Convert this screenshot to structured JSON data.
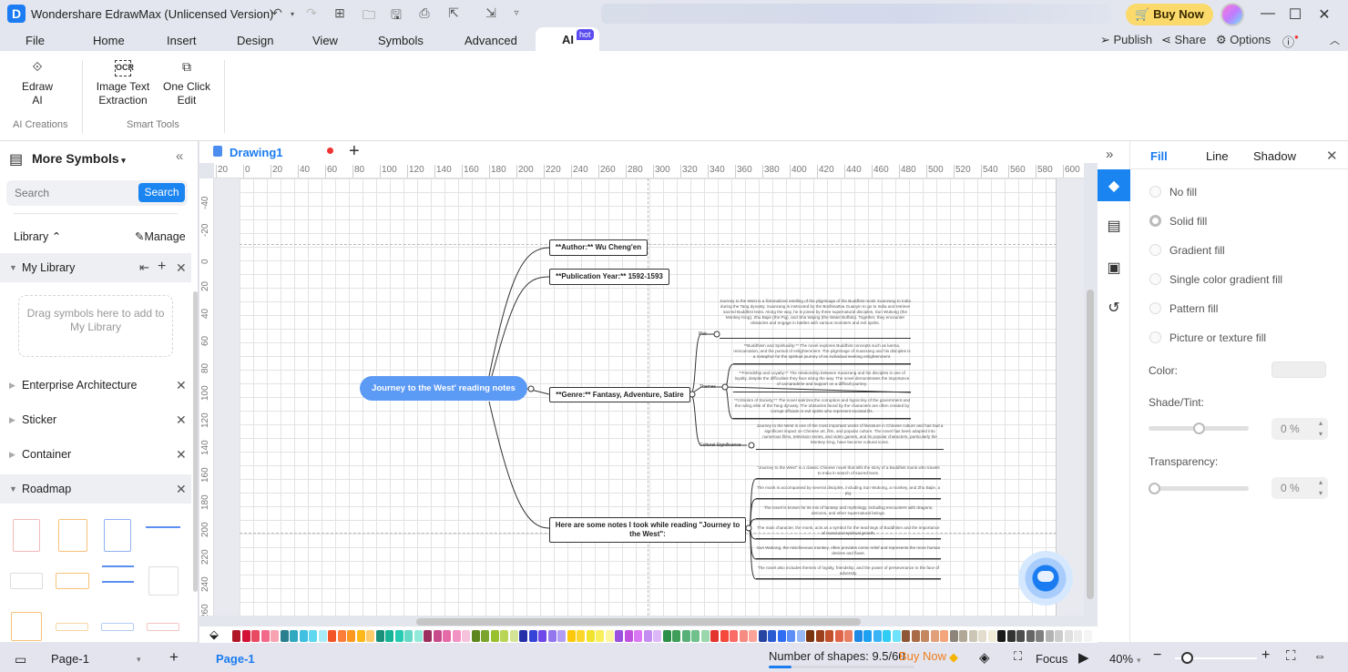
{
  "app": {
    "title": "Wondershare EdrawMax (Unlicensed Version)",
    "logo_glyph": "D",
    "buy_now": "Buy Now",
    "quick_access": [
      "undo",
      "redo",
      "new",
      "open",
      "save",
      "print",
      "export",
      "import",
      "more"
    ]
  },
  "menu": {
    "tabs": [
      "File",
      "Home",
      "Insert",
      "Design",
      "View",
      "Symbols",
      "Advanced"
    ],
    "active_tab": "AI",
    "hot_badge": "hot",
    "right": {
      "publish": "Publish",
      "share": "Share",
      "options": "Options"
    }
  },
  "ribbon": {
    "buttons": [
      {
        "icon": "edraw-ai-icon",
        "label1": "Edraw",
        "label2": "AI"
      },
      {
        "icon": "ocr-icon",
        "label1": "Image Text",
        "label2": "Extraction"
      },
      {
        "icon": "one-click-edit-icon",
        "label1": "One Click",
        "label2": "Edit"
      }
    ],
    "groups": [
      "AI Creations",
      "Smart Tools"
    ]
  },
  "left_panel": {
    "title": "More Symbols",
    "search_placeholder": "Search",
    "search_button": "Search",
    "library_label": "Library",
    "manage_label": "Manage",
    "my_library": "My Library",
    "drag_hint": "Drag symbols here to add to My Library",
    "libraries": [
      "Enterprise Architecture",
      "Sticker",
      "Container",
      "Roadmap"
    ]
  },
  "document": {
    "tab_label": "Drawing1",
    "ruler_top": [
      "20",
      "0",
      "20",
      "40",
      "60",
      "80",
      "100",
      "120",
      "140",
      "160",
      "180",
      "200",
      "220",
      "240",
      "260",
      "280",
      "300",
      "320",
      "340",
      "360",
      "380",
      "400",
      "420",
      "440",
      "460",
      "480",
      "500",
      "520",
      "540",
      "560",
      "580",
      "600"
    ],
    "ruler_left": [
      "-40",
      "-20",
      "0",
      "20",
      "40",
      "60",
      "80",
      "100",
      "120",
      "140",
      "160",
      "180",
      "200",
      "220",
      "240",
      "260"
    ]
  },
  "mindmap": {
    "root": "Journey to the West' reading notes",
    "author": "**Author:** Wu Cheng'en",
    "year": "**Publication Year:** 1592-1593",
    "genre": "**Genre:** Fantasy, Adventure, Satire",
    "notes_title": "Here are some notes I took while reading \"Journey to the West\":",
    "genre_branches": {
      "plot": "Plot",
      "themes": "Themes",
      "cultural": "Cultural Significance"
    },
    "plot_text": "Journey to the West is a fictionalized retelling of the pilgrimage of the Buddhist monk Xuanzang to India during the Tang dynasty. Xuanzang is instructed by the Bodhisattva Guanyin to go to India and retrieve sacred Buddhist texts. Along the way, he is joined by three supernatural disciples, Sun Wukong (the Monkey King), Zhu Bajie (the Pig), and Sha Wujing (the Water Buffalo). Together, they encounter obstacles and engage in battles with various monsters and evil spirits.",
    "themes": [
      "**Buddhism and Spirituality:** The novel explores Buddhist concepts such as karma, reincarnation, and the pursuit of enlightenment. The pilgrimage of Xuanzang and his disciples is a metaphor for the spiritual journey of an individual seeking enlightenment.",
      "**Friendship and Loyalty:** The relationship between Xuanzang and his disciples is one of loyalty, despite the difficulties they face along the way. The novel demonstrates the importance of camaraderie and support on a difficult journey.",
      "**Criticism of Society:** The novel satirizes the corruption and hypocrisy of the government and the ruling elite of the Tang dynasty. The obstacles faced by the characters are often created by corrupt officials or evil spirits who represent societal ills."
    ],
    "cultural_text": "Journey to the West is one of the most important works of literature in Chinese culture and has had a significant impact on Chinese art, film, and popular culture. The novel has been adapted into numerous films, television series, and video games, and its popular characters, particularly the Monkey King, have become cultural icons.",
    "notes": [
      "\"Journey to the West\" is a classic Chinese novel that tells the story of a Buddhist monk who travels to India in search of sacred texts.",
      "The monk is accompanied by several disciples, including Sun Wukong, a monkey, and Zhu Bajie, a pig.",
      "The novel is known for its mix of fantasy and mythology, including encounters with dragons, demons, and other supernatural beings.",
      "The main character, the monk, acts as a symbol for the teachings of Buddhism and the importance of moral and spiritual growth.",
      "Sun Wukong, the mischievous monkey, often provides comic relief and represents the more human desires and flaws.",
      "The novel also includes themes of loyalty, friendship, and the power of perseverance in the face of adversity."
    ]
  },
  "palette": [
    "#b0182a",
    "#d31336",
    "#e84a63",
    "#f2698a",
    "#f7a3b2",
    "#2a7f8e",
    "#31a8c2",
    "#3fc0e0",
    "#5fd8ef",
    "#a8ecf7",
    "#f45528",
    "#fb7f3b",
    "#fb981f",
    "#fdb91a",
    "#fdcb69",
    "#19907a",
    "#17b397",
    "#27cbb1",
    "#65d9c6",
    "#92eadb",
    "#9c2f5e",
    "#c84c8c",
    "#e46aa8",
    "#f393c5",
    "#f6c1da",
    "#5e871d",
    "#7ba52c",
    "#99c12e",
    "#b9d556",
    "#d3e496",
    "#2530a8",
    "#3543d6",
    "#7047e8",
    "#9476ee",
    "#b29ff3",
    "#fbc90a",
    "#fdd62b",
    "#efe32e",
    "#f8ef5a",
    "#fbf59b",
    "#9b50e0",
    "#c151df",
    "#d978f2",
    "#c48df2",
    "#dcb8f8",
    "#2d8f4a",
    "#3f9e59",
    "#59b179",
    "#6fc08b",
    "#9bd7ad",
    "#e4362e",
    "#f4493c",
    "#fb6c67",
    "#f58b81",
    "#fba399",
    "#2744a3",
    "#2c5cd4",
    "#2f6df2",
    "#5d8ff6",
    "#97b9f6",
    "#7a3410",
    "#9b3f1c",
    "#c2502b",
    "#e06447",
    "#e98066",
    "#1e8ae3",
    "#1ea0f0",
    "#3ab4f7",
    "#2fccf4",
    "#6fe3fc",
    "#8e5838",
    "#a96b48",
    "#c48760",
    "#e1a078",
    "#f3a57c",
    "#8e857a",
    "#b1a996",
    "#cbc6b6",
    "#e1dccb",
    "#f1ecd8",
    "#1a1a1a",
    "#333333",
    "#4d4d4d",
    "#666666",
    "#808080",
    "#b3b3b3",
    "#cccccc",
    "#e0e0e0",
    "#ececec",
    "#f5f5f5"
  ],
  "right_panel": {
    "tabs": [
      "Fill",
      "Line",
      "Shadow"
    ],
    "active_tab": "Fill",
    "fill_options": [
      "No fill",
      "Solid fill",
      "Gradient fill",
      "Single color gradient fill",
      "Pattern fill",
      "Picture or texture fill"
    ],
    "selected_option": "Solid fill",
    "color_label": "Color:",
    "color_value": "#eeeeee",
    "shade_label": "Shade/Tint:",
    "shade_value": "0 %",
    "shade_fraction": 0.5,
    "transparency_label": "Transparency:",
    "transparency_value": "0 %",
    "transparency_fraction": 0.0
  },
  "status": {
    "page_selector": "Page-1",
    "page_tab": "Page-1",
    "shapes_label": "Number of shapes: 9.5/60",
    "shapes_fraction": 0.158,
    "buy_now": "Buy Now",
    "focus": "Focus",
    "zoom": "40%",
    "zoom_fraction": 0.1
  }
}
